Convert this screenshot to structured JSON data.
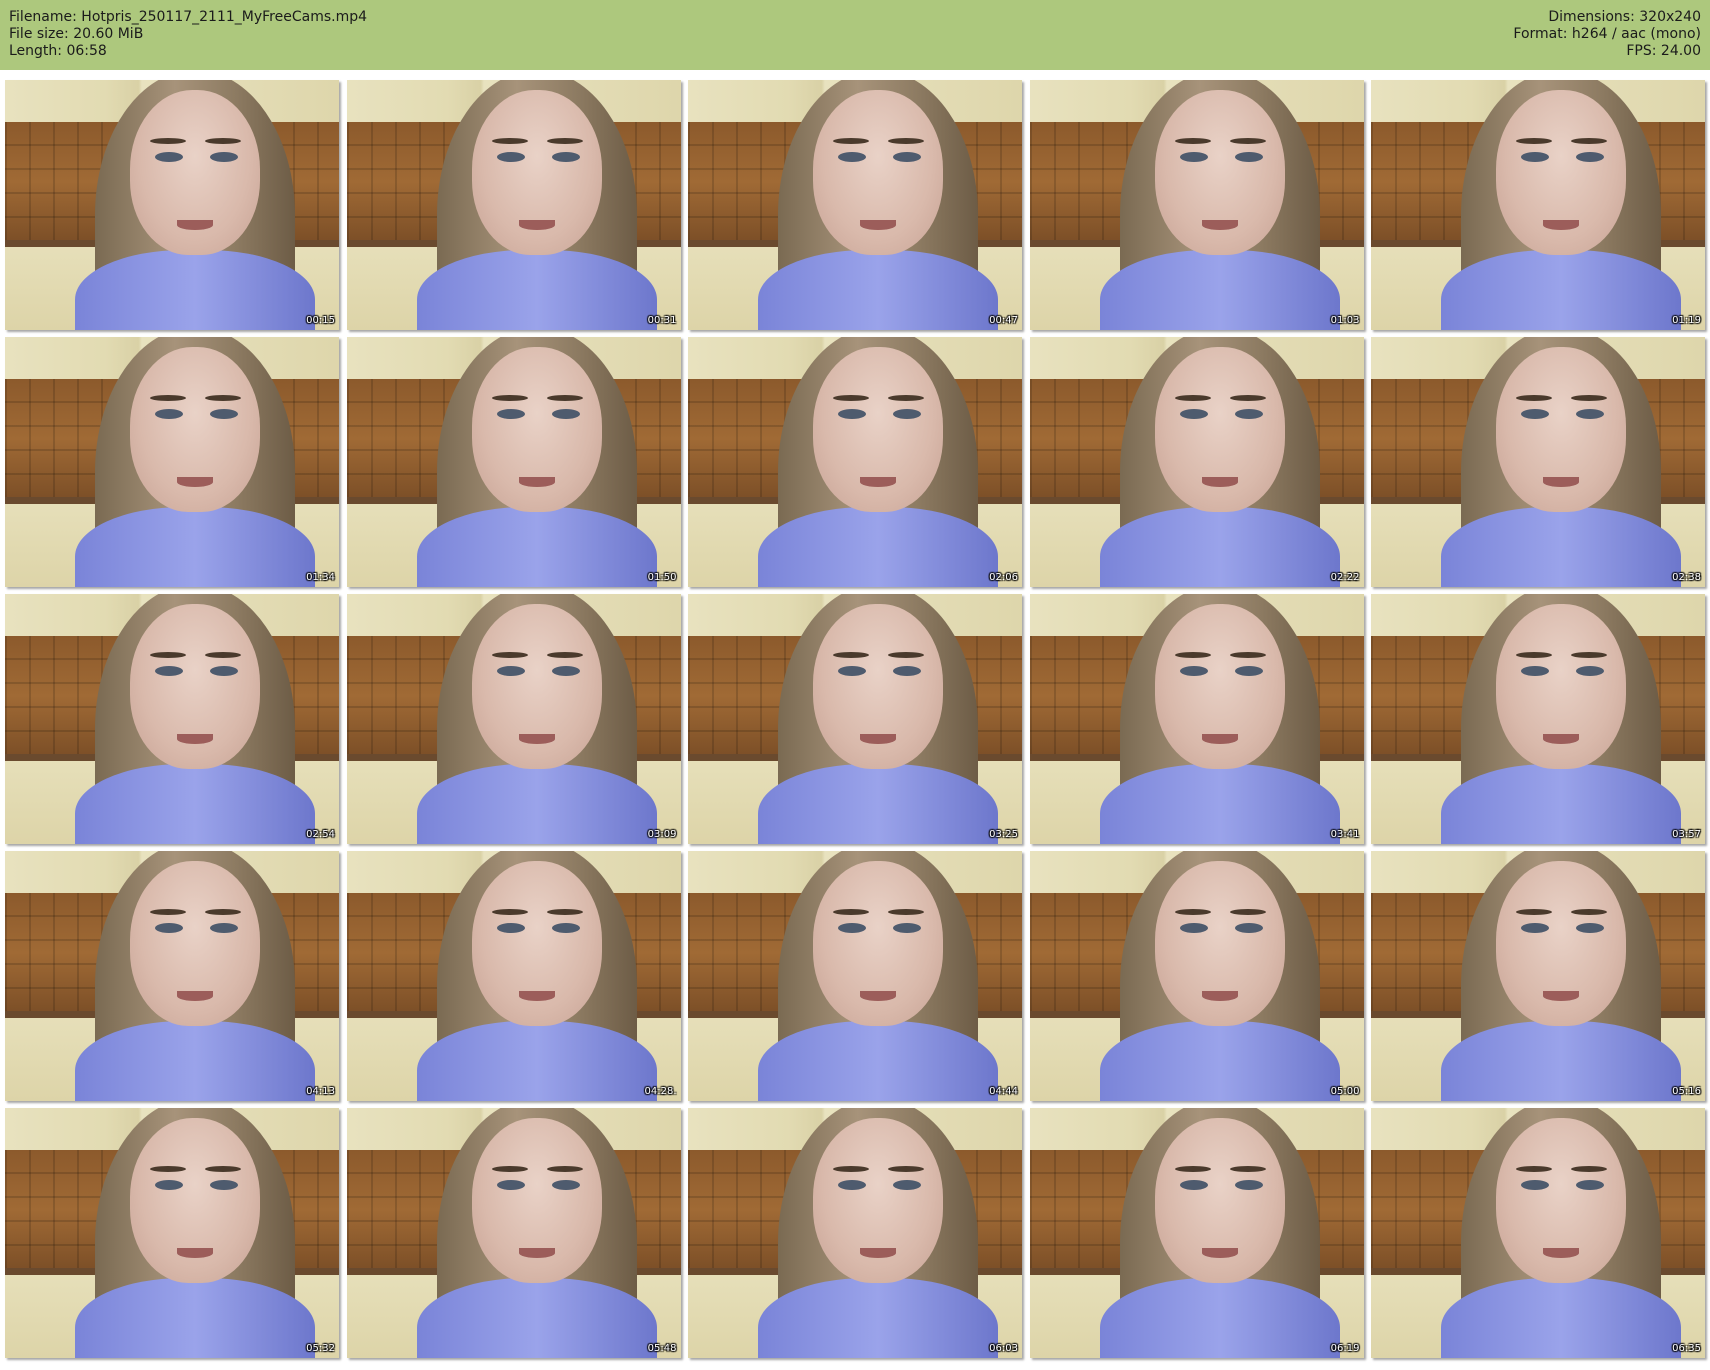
{
  "header": {
    "filename_line": "Filename: Hotpris_250117_2111_MyFreeCams.mp4",
    "filesize_line": "File size: 20.60 MiB",
    "length_line": "Length: 06:58",
    "dimensions_line": "Dimensions: 320x240",
    "format_line": "Format: h264 / aac (mono)",
    "fps_line": "FPS: 24.00"
  },
  "thumbnails": [
    {
      "timestamp": "00:15"
    },
    {
      "timestamp": "00:31"
    },
    {
      "timestamp": "00:47"
    },
    {
      "timestamp": "01:03"
    },
    {
      "timestamp": "01:19"
    },
    {
      "timestamp": "01:34"
    },
    {
      "timestamp": "01:50"
    },
    {
      "timestamp": "02:06"
    },
    {
      "timestamp": "02:22"
    },
    {
      "timestamp": "02:38"
    },
    {
      "timestamp": "02:54"
    },
    {
      "timestamp": "03:09"
    },
    {
      "timestamp": "03:25"
    },
    {
      "timestamp": "03:41"
    },
    {
      "timestamp": "03:57"
    },
    {
      "timestamp": "04:13"
    },
    {
      "timestamp": "04:28."
    },
    {
      "timestamp": "04:44"
    },
    {
      "timestamp": "05:00"
    },
    {
      "timestamp": "05:16"
    },
    {
      "timestamp": "05:32"
    },
    {
      "timestamp": "05:48"
    },
    {
      "timestamp": "06:03"
    },
    {
      "timestamp": "06:19"
    },
    {
      "timestamp": "06:35"
    }
  ],
  "colors": {
    "header_bg": "#adc87d",
    "page_bg": "#ffffff",
    "timestamp_text": "#ffffff"
  }
}
